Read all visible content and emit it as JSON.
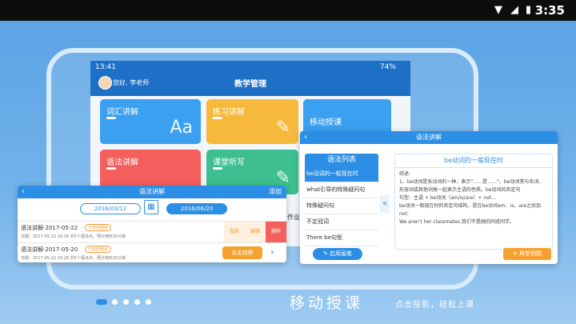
{
  "status": {
    "time": "3:35"
  },
  "tablet": {
    "time": "13:41",
    "battery": "74%",
    "greeting": "您好, 李老师",
    "title": "教学管理",
    "tiles": [
      {
        "label": "词汇讲解",
        "color": "#3aa0ef",
        "icon": "Aa"
      },
      {
        "label": "练习讲解",
        "color": "#f6b93b",
        "icon": "✎"
      },
      {
        "label": "移动授课",
        "color": "#3aa0ef",
        "icon": ""
      },
      {
        "label": "语法讲解",
        "color": "#f25f5c",
        "icon": ""
      },
      {
        "label": "课堂听写",
        "color": "#3dbf8f",
        "icon": "✎"
      }
    ],
    "partial_label": "作业"
  },
  "lecture_card": {
    "title": "语法讲解",
    "add_label": "添加",
    "date_start": "2016/03/12",
    "date_end": "2016/06/20",
    "rows": [
      {
        "name": "语法讲解-2017-05-22",
        "badge": "已讲授题目",
        "meta": "日期：2017-05-22   16:28  共5个语法点，预计用时20分钟",
        "actions": [
          "投影",
          "编辑",
          "删除"
        ]
      },
      {
        "name": "语法讲解-2017-05-20",
        "badge": "已讲授题目",
        "meta": "日期：2017-05-22   16:28  共5个语法点，预计用时20分钟",
        "project_button": "点击投影"
      }
    ]
  },
  "grammar_card": {
    "title": "语法讲解",
    "list_title": "语法列表",
    "items": [
      "be动词的一般现在时",
      "what引导的特殊疑问句",
      "特殊疑问句",
      "不定冠词",
      "There be句型"
    ],
    "detail_title": "be动词的一般现在时",
    "detail_body": "综述:\n1、be动词是系动词的一种，表示\"……是……\"。be动词常与名词、形容词或其他词类一起表示主语的性质。be动词的否定句\n句型：主语 + be动词（am/is/are）+ not…\nbe动词一般现在时的否定句结构，是在be动词am、is、are之后加not:\nWe aren't her classmates.我们不是她的同班同学。",
    "pen_button": "启用画笔",
    "example_button": "典型例题"
  },
  "caption": "移动授课",
  "subcaption": "点击投影，轻松上课",
  "colors": {
    "accent": "#2c8ee4",
    "orange": "#f29b38"
  }
}
